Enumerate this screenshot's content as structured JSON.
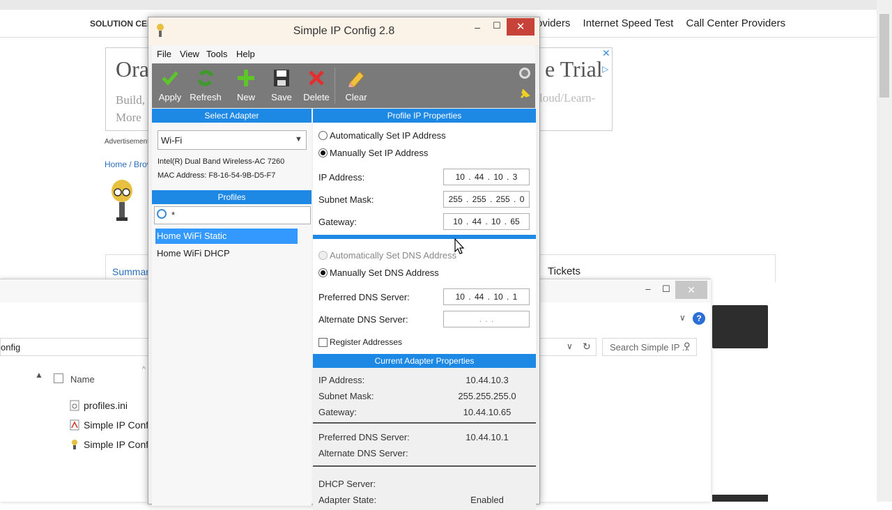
{
  "web": {
    "nav_left": "SOLUTION CEN",
    "nav_right": [
      "oviders",
      "Internet Speed Test",
      "Call Center Providers"
    ],
    "ad_title": "Ora",
    "ad_trial": "e Trial",
    "ad_body": "Build, I More",
    "ad_url": "loud/Learn-",
    "ad_label": "Advertisement",
    "breadcrumb": "Home / Brov",
    "summary_tab": "Summar",
    "tickets_tab": "Tickets"
  },
  "explorer": {
    "address": "onfig",
    "search_placeholder": "Search Simple IP ...",
    "column_name": "Name",
    "files": [
      "profiles.ini",
      "Simple IP Config",
      "Simple IP Config"
    ]
  },
  "app": {
    "title": "Simple IP Config 2.8",
    "menu": [
      "File",
      "View",
      "Tools",
      "Help"
    ],
    "toolbar": [
      "Apply",
      "Refresh",
      "New",
      "Save",
      "Delete",
      "Clear"
    ],
    "select_adapter_header": "Select Adapter",
    "adapter": "Wi-Fi",
    "adapter_description": "Intel(R) Dual Band Wireless-AC 7260",
    "mac_address": "MAC Address: F8-16-54-9B-D5-F7",
    "profiles_header": "Profiles",
    "profile_filter": "*",
    "profiles": [
      "Home WiFi Static",
      "Home WiFi DHCP"
    ],
    "profile_ip_header": "Profile IP Properties",
    "auto_ip_label": "Automatically Set IP Address",
    "manual_ip_label": "Manually Set IP Address",
    "ip_label": "IP Address:",
    "ip_value": "10 . 44 . 10 . 3",
    "subnet_label": "Subnet Mask:",
    "subnet_value": "255 . 255 . 255 . 0",
    "gateway_label": "Gateway:",
    "gateway_value": "10 . 44 . 10 . 65",
    "auto_dns_label": "Automatically Set DNS Address",
    "manual_dns_label": "Manually Set DNS Address",
    "pref_dns_label": "Preferred DNS Server:",
    "pref_dns_value": "10 . 44 . 10 . 1",
    "alt_dns_label": "Alternate DNS Server:",
    "alt_dns_value": ". . .",
    "register_label": "Register Addresses",
    "current_header": "Current Adapter Properties",
    "current": {
      "ip_label": "IP Address:",
      "ip": "10.44.10.3",
      "subnet_label": "Subnet Mask:",
      "subnet": "255.255.255.0",
      "gateway_label": "Gateway:",
      "gateway": "10.44.10.65",
      "pref_dns_label": "Preferred DNS Server:",
      "pref_dns": "10.44.10.1",
      "alt_dns_label": "Alternate DNS Server:",
      "dhcp_label": "DHCP Server:",
      "state_label": "Adapter State:",
      "state": "Enabled"
    }
  },
  "colors": {
    "accent_blue": "#1e88e5",
    "selection": "#3399ff",
    "toolbar_bg": "#7a7a7a",
    "close_red": "#c7433a"
  }
}
